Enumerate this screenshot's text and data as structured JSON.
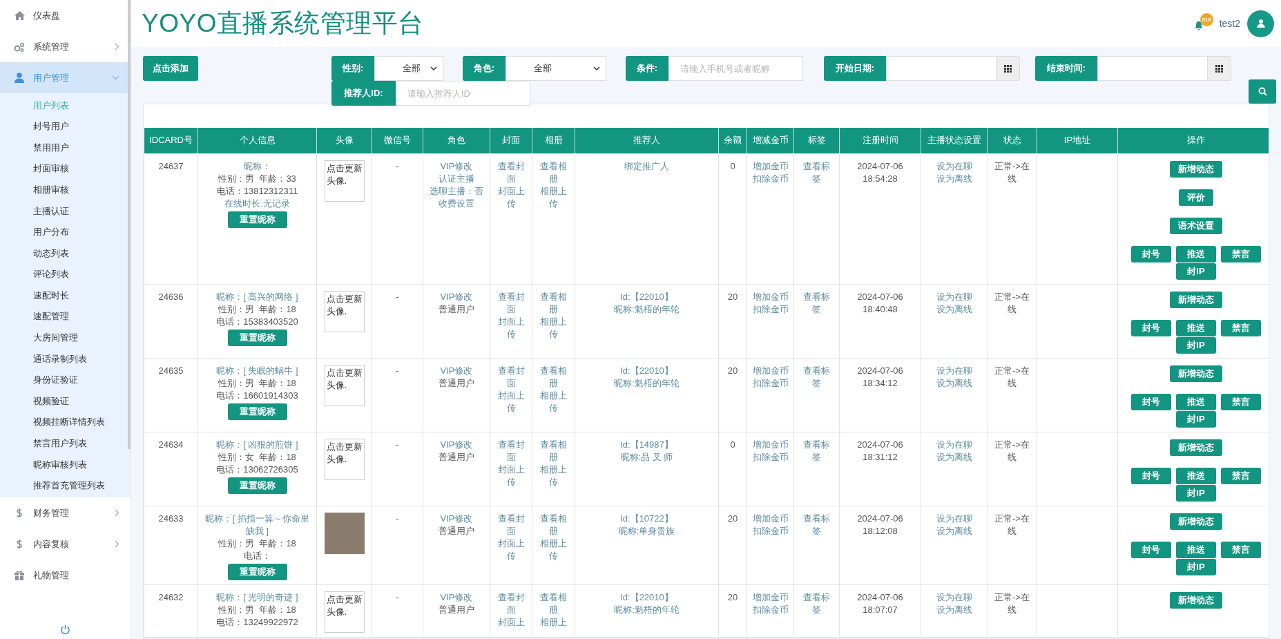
{
  "sidebar": {
    "items": [
      {
        "label": "仪表盘",
        "kind": "link",
        "selected": false
      },
      {
        "label": "系统管理",
        "kind": "menu",
        "expanded": false,
        "selected": false
      },
      {
        "label": "用户管理",
        "kind": "menu",
        "expanded": true,
        "selected": true,
        "children": [
          {
            "label": "用户列表",
            "selected": true
          },
          {
            "label": "封号用户",
            "selected": false
          },
          {
            "label": "禁用用户",
            "selected": false
          },
          {
            "label": "封面审核",
            "selected": false
          },
          {
            "label": "相册审核",
            "selected": false
          },
          {
            "label": "主播认证",
            "selected": false
          },
          {
            "label": "用户分布",
            "selected": false
          },
          {
            "label": "动态列表",
            "selected": false
          },
          {
            "label": "评论列表",
            "selected": false
          },
          {
            "label": "速配时长",
            "selected": false
          },
          {
            "label": "速配管理",
            "selected": false
          },
          {
            "label": "大房间管理",
            "selected": false
          },
          {
            "label": "通话录制列表",
            "selected": false
          },
          {
            "label": "身份证验证",
            "selected": false
          },
          {
            "label": "视频验证",
            "selected": false
          },
          {
            "label": "视频挂断详情列表",
            "selected": false
          },
          {
            "label": "禁言用户列表",
            "selected": false
          },
          {
            "label": "昵称审核列表",
            "selected": false
          },
          {
            "label": "推荐首充管理列表",
            "selected": false
          }
        ]
      },
      {
        "label": "财务管理",
        "kind": "menu",
        "expanded": false,
        "selected": false
      },
      {
        "label": "内容复核",
        "kind": "menu",
        "expanded": false,
        "selected": false
      },
      {
        "label": "礼物管理",
        "kind": "link",
        "selected": false
      }
    ]
  },
  "header": {
    "title": "YOYO直播系统管理平台",
    "notification_badge": "818",
    "username": "test2"
  },
  "toolbar": {
    "add_button": "点击添加",
    "filters": [
      {
        "kind": "select",
        "label": "性别:",
        "value": "全部"
      },
      {
        "kind": "select",
        "label": "角色:",
        "value": "全部"
      },
      {
        "kind": "input",
        "label": "条件:",
        "placeholder": "请输入手机号或者昵称"
      },
      {
        "kind": "date",
        "label": "开始日期:"
      },
      {
        "kind": "date",
        "label": "结束时间:"
      },
      {
        "kind": "input",
        "label": "推荐人ID:",
        "placeholder": "请输入推荐人ID"
      }
    ]
  },
  "table": {
    "columns": [
      "IDCARD号",
      "个人信息",
      "头像",
      "微信号",
      "角色",
      "封面",
      "相册",
      "推荐人",
      "余额",
      "增减金币",
      "标签",
      "注册时间",
      "主播状态设置",
      "状态",
      "IP地址",
      "操作"
    ],
    "rows": [
      {
        "id": "24637",
        "nickname": "昵称：",
        "gender_age": "性别：男  年龄：33",
        "phone": "电话：13812312311",
        "online_time": "在线时长:无记录",
        "reset_button": "重置昵称",
        "avatar": {
          "kind": "broken",
          "alt": "点击更新头像."
        },
        "wechat": "-",
        "role": [
          {
            "kind": "link",
            "text": "VIP修改"
          },
          {
            "kind": "link",
            "text": "认证主播"
          },
          {
            "kind": "link",
            "text": "选聊主播：否"
          },
          {
            "kind": "link",
            "text": "收费设置"
          }
        ],
        "cover": [
          "查看封面",
          "封面上传"
        ],
        "album": [
          "查看相册",
          "相册上传"
        ],
        "referrer": [
          "绑定推广人"
        ],
        "balance": "0",
        "coins": [
          "增加金币",
          "扣除金币"
        ],
        "tags": "查看标签",
        "registered": [
          "2024-07-06",
          "18:54:28"
        ],
        "anchor_status": [
          "设为在聊",
          "设为离线"
        ],
        "status": "正常->在线",
        "actions": [
          "新增动态",
          "评价",
          "语术设置"
        ],
        "ban_actions": [
          "封号",
          "推送",
          "禁言",
          "封IP"
        ]
      },
      {
        "id": "24636",
        "nickname": "昵称：[ 高兴的网络 ]",
        "gender_age": "性别：男  年龄：18",
        "phone": "电话：15383403520",
        "reset_button": "重置昵称",
        "avatar": {
          "kind": "broken",
          "alt": "点击更新头像."
        },
        "wechat": "-",
        "role": [
          {
            "kind": "link",
            "text": "VIP修改"
          },
          {
            "kind": "text",
            "text": "普通用户"
          }
        ],
        "cover": [
          "查看封面",
          "封面上传"
        ],
        "album": [
          "查看相册",
          "相册上传"
        ],
        "referrer": [
          "Id:【22010】",
          "昵称:魁梧的年轮"
        ],
        "balance": "20",
        "coins": [
          "增加金币",
          "扣除金币"
        ],
        "tags": "查看标签",
        "registered": [
          "2024-07-06",
          "18:40:48"
        ],
        "anchor_status": [
          "设为在聊",
          "设为离线"
        ],
        "status": "正常->在线",
        "actions": [
          "新增动态"
        ],
        "ban_actions": [
          "封号",
          "推送",
          "禁言",
          "封IP"
        ]
      },
      {
        "id": "24635",
        "nickname": "昵称：[ 失眠的蜗牛 ]",
        "gender_age": "性别：男  年龄：18",
        "phone": "电话：16601914303",
        "reset_button": "重置昵称",
        "avatar": {
          "kind": "broken",
          "alt": "点击更新头像."
        },
        "wechat": "-",
        "role": [
          {
            "kind": "link",
            "text": "VIP修改"
          },
          {
            "kind": "text",
            "text": "普通用户"
          }
        ],
        "cover": [
          "查看封面",
          "封面上传"
        ],
        "album": [
          "查看相册",
          "相册上传"
        ],
        "referrer": [
          "Id:【22010】",
          "昵称:魁梧的年轮"
        ],
        "balance": "20",
        "coins": [
          "增加金币",
          "扣除金币"
        ],
        "tags": "查看标签",
        "registered": [
          "2024-07-06",
          "18:34:12"
        ],
        "anchor_status": [
          "设为在聊",
          "设为离线"
        ],
        "status": "正常->在线",
        "actions": [
          "新增动态"
        ],
        "ban_actions": [
          "封号",
          "推送",
          "禁言",
          "封IP"
        ]
      },
      {
        "id": "24634",
        "nickname": "昵称：[ 凶狠的煎饼 ]",
        "gender_age": "性别：女  年龄：18",
        "phone": "电话：13062726305",
        "reset_button": "重置昵称",
        "avatar": {
          "kind": "broken",
          "alt": "点击更新头像."
        },
        "wechat": "-",
        "role": [
          {
            "kind": "link",
            "text": "VIP修改"
          },
          {
            "kind": "text",
            "text": "普通用户"
          }
        ],
        "cover": [
          "查看封面",
          "封面上传"
        ],
        "album": [
          "查看相册",
          "相册上传"
        ],
        "referrer": [
          "Id:【14987】",
          "昵称:品 叉 师"
        ],
        "balance": "0",
        "coins": [
          "增加金币",
          "扣除金币"
        ],
        "tags": "查看标签",
        "registered": [
          "2024-07-06",
          "18:31:12"
        ],
        "anchor_status": [
          "设为在聊",
          "设为离线"
        ],
        "status": "正常->在线",
        "actions": [
          "新增动态"
        ],
        "ban_actions": [
          "封号",
          "推送",
          "禁言",
          "封IP"
        ]
      },
      {
        "id": "24633",
        "nickname": "昵称：[ 掐指一算～你命里缺我 ]",
        "gender_age": "性别：男  年龄：18",
        "phone": "电话：",
        "reset_button": "重置昵称",
        "avatar": {
          "kind": "photo"
        },
        "wechat": "-",
        "role": [
          {
            "kind": "link",
            "text": "VIP修改"
          },
          {
            "kind": "text",
            "text": "普通用户"
          }
        ],
        "cover": [
          "查看封面",
          "封面上传"
        ],
        "album": [
          "查看相册",
          "相册上传"
        ],
        "referrer": [
          "Id:【10722】",
          "昵称:单身贵族"
        ],
        "balance": "20",
        "coins": [
          "增加金币",
          "扣除金币"
        ],
        "tags": "查看标签",
        "registered": [
          "2024-07-06",
          "18:12:08"
        ],
        "anchor_status": [
          "设为在聊",
          "设为离线"
        ],
        "status": "正常->在线",
        "actions": [
          "新增动态"
        ],
        "ban_actions": [
          "封号",
          "推送",
          "禁言",
          "封IP"
        ]
      },
      {
        "id": "24632",
        "nickname": "昵称：[ 光明的奇迹 ]",
        "gender_age": "性别：男  年龄：18",
        "phone": "电话：13249922972",
        "avatar": {
          "kind": "broken",
          "alt": "点击更新头像."
        },
        "wechat": "-",
        "role": [
          {
            "kind": "link",
            "text": "VIP修改"
          },
          {
            "kind": "text",
            "text": "普通用户"
          }
        ],
        "cover": [
          "查看封面",
          "封面上"
        ],
        "album": [
          "查看相册",
          "相册上"
        ],
        "referrer": [
          "Id:【22010】",
          "昵称:魁梧的年轮"
        ],
        "balance": "20",
        "coins": [
          "增加金币",
          "扣除金币"
        ],
        "tags": "查看标签",
        "registered": [
          "2024-07-06",
          "18:07:07"
        ],
        "anchor_status": [
          "设为在聊",
          "设为离线"
        ],
        "status": "正常->在线",
        "actions": [
          "新增动态"
        ]
      }
    ]
  }
}
